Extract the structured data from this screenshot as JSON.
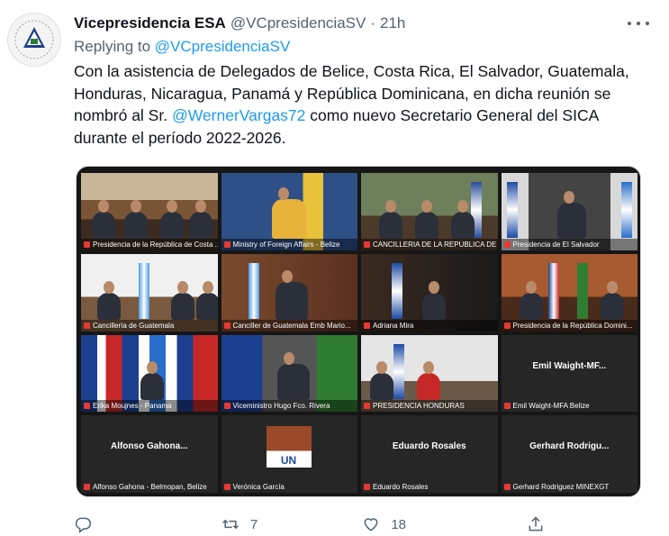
{
  "tweet": {
    "author_name": "Vicepresidencia ESA",
    "author_handle": "@VCpresidenciaSV",
    "separator": "·",
    "time": "21h",
    "replying_prefix": "Replying to",
    "replying_to": "@VCpresidenciaSV",
    "text_part1": "Con la asistencia de Delegados de Belice, Costa Rica,  El Salvador, Guatemala, Honduras, Nicaragua, Panamá y República Dominicana, en dicha reunión se nombró al Sr. ",
    "mention": "@WernerVargas72",
    "text_part2": " como nuevo Secretario General del SICA durante el período 2022-2026."
  },
  "video_call": {
    "tiles": [
      {
        "label": "Presidencia de la República de Costa ..."
      },
      {
        "label": "Ministry of Foreign Affairs - Belize"
      },
      {
        "label": "CANCILLERIA DE LA REPUBLICA DE ..."
      },
      {
        "label": "Presidencia de El Salvador"
      },
      {
        "label": "Cancillería de Guatemala"
      },
      {
        "label": "Canciller de Guatemala Emb Mario..."
      },
      {
        "label": "Adriana Mira"
      },
      {
        "label": "Presidencia de la República Domini..."
      },
      {
        "label": "Erika Moujnes - Panama"
      },
      {
        "label": "Viceministro Hugo Fco. Rivera"
      },
      {
        "label": "PRESIDENCIA HONDURAS"
      },
      {
        "label": "Emil Waight-MFA Belize",
        "display_name": "Emil Waight-MF..."
      },
      {
        "label": "Alfonso Gahona - Belmopan, Belize",
        "display_name": "Alfonso Gahona..."
      },
      {
        "label": "Verónica García",
        "logo_text": "UN"
      },
      {
        "label": "Eduardo Rosales",
        "display_name": "Eduardo Rosales"
      },
      {
        "label": "Gerhard Rodriguez MINEXGT",
        "display_name": "Gerhard Rodrigu..."
      }
    ]
  },
  "actions": {
    "reply_count": "",
    "retweet_count": "7",
    "like_count": "18"
  },
  "colors": {
    "accent": "#1d9bf0",
    "secondary_text": "#536471",
    "active_speaker": "#b7e04e"
  }
}
